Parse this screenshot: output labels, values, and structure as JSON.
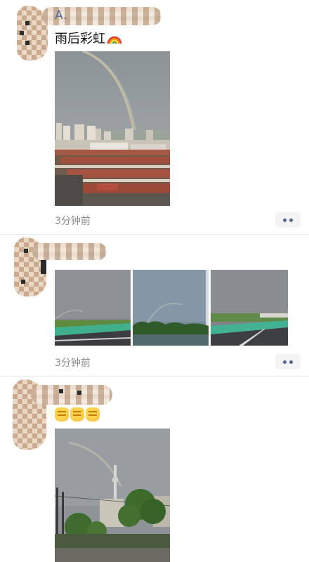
{
  "posts": [
    {
      "username": "A.",
      "text": "雨后彩虹",
      "emoji": "rainbow-emoji",
      "time": "3分钟前"
    },
    {
      "username": "",
      "text": "",
      "emoji": "",
      "time": "3分钟前"
    },
    {
      "username": "",
      "text": "",
      "emoji": "fist-emoji ×3",
      "time": ""
    }
  ],
  "colors": {
    "link_blue": "#576b95",
    "time_gray": "#8c8c8c",
    "divider": "#e6e6e6",
    "more_btn_bg": "#f4f4f4"
  }
}
